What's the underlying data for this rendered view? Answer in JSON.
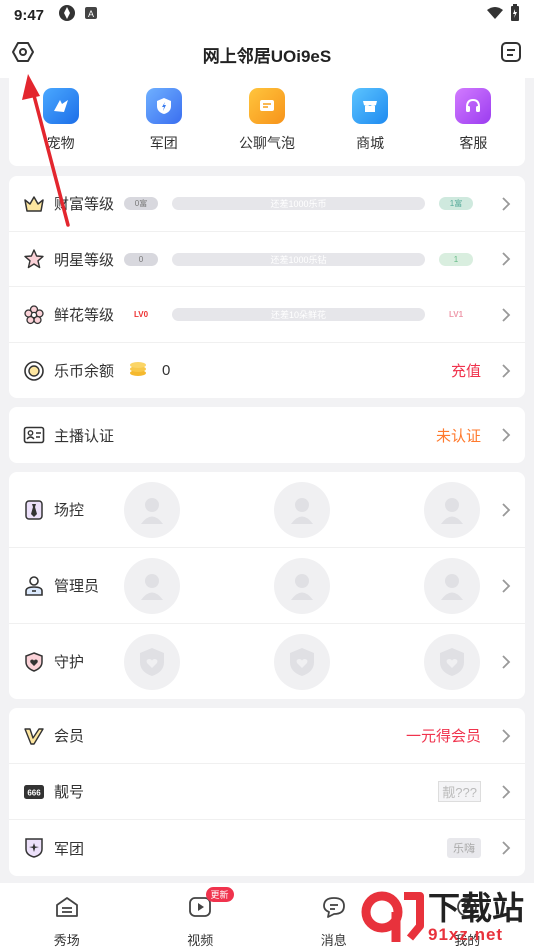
{
  "status": {
    "time": "9:47"
  },
  "header": {
    "title": "网上邻居UOi9eS"
  },
  "quick": [
    {
      "label": "宠物",
      "icon": "pet-icon",
      "color": "#2d8cf5"
    },
    {
      "label": "军团",
      "icon": "legion-icon",
      "color": "#3a7cf0"
    },
    {
      "label": "公聊气泡",
      "icon": "bubble-icon",
      "color": "#f7a11a"
    },
    {
      "label": "商城",
      "icon": "shop-icon",
      "color": "#2e9cf5"
    },
    {
      "label": "客服",
      "icon": "service-icon",
      "color": "#b04cf2"
    }
  ],
  "levels": {
    "wealth": {
      "label": "财富等级",
      "left": "0富",
      "bar": "还差1000乐币",
      "right": "1富"
    },
    "star": {
      "label": "明星等级",
      "left": "0",
      "bar": "还差1000乐钻",
      "right": "1"
    },
    "flower": {
      "label": "鲜花等级",
      "left": "LV0",
      "bar": "还差10朵鲜花",
      "right": "LV1"
    },
    "coins": {
      "label": "乐币余额",
      "value": "0",
      "action": "充值"
    }
  },
  "cert": {
    "label": "主播认证",
    "status": "未认证"
  },
  "roles": [
    {
      "label": "场控"
    },
    {
      "label": "管理员"
    },
    {
      "label": "守护"
    }
  ],
  "member": {
    "vip": {
      "label": "会员",
      "action": "一元得会员"
    },
    "number": {
      "label": "靓号",
      "value": "靓???"
    },
    "legion": {
      "label": "军团",
      "value": "乐嗨"
    }
  },
  "tabs": [
    {
      "label": "秀场",
      "icon": "home-icon"
    },
    {
      "label": "视频",
      "icon": "video-icon",
      "badge": "更新"
    },
    {
      "label": "消息",
      "icon": "message-icon"
    },
    {
      "label": "我的",
      "icon": "profile-icon"
    }
  ],
  "watermark": {
    "text": "下载站",
    "sub": "91xz.net"
  },
  "colors": {
    "accent": "#f0334d",
    "orange": "#ff7a2e",
    "arrow": "#e3262e"
  }
}
